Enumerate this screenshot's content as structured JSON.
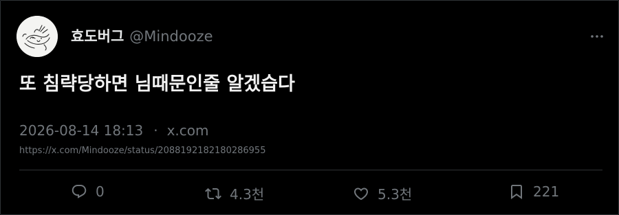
{
  "author": {
    "display_name": "효도버그",
    "handle": "@Mindooze",
    "avatar_icon": "sketch-avatar-icon"
  },
  "tweet": {
    "text": "또 침략당하면 님때문인줄 알겠습다",
    "timestamp": "2026-08-14 18:13",
    "separator": "·",
    "source": "x.com",
    "url": "https://x.com/Mindooze/status/2088192182180286955"
  },
  "actions": {
    "reply": {
      "icon": "reply-icon",
      "count": "0"
    },
    "retweet": {
      "icon": "retweet-icon",
      "count": "4.3천"
    },
    "like": {
      "icon": "heart-icon",
      "count": "5.3천"
    },
    "bookmark": {
      "icon": "bookmark-icon",
      "count": "221"
    }
  },
  "menu": {
    "icon": "more-icon"
  },
  "colors": {
    "background": "#000000",
    "primary_text": "#e7e9ea",
    "secondary_text": "#71767b",
    "border": "#2f3336"
  }
}
